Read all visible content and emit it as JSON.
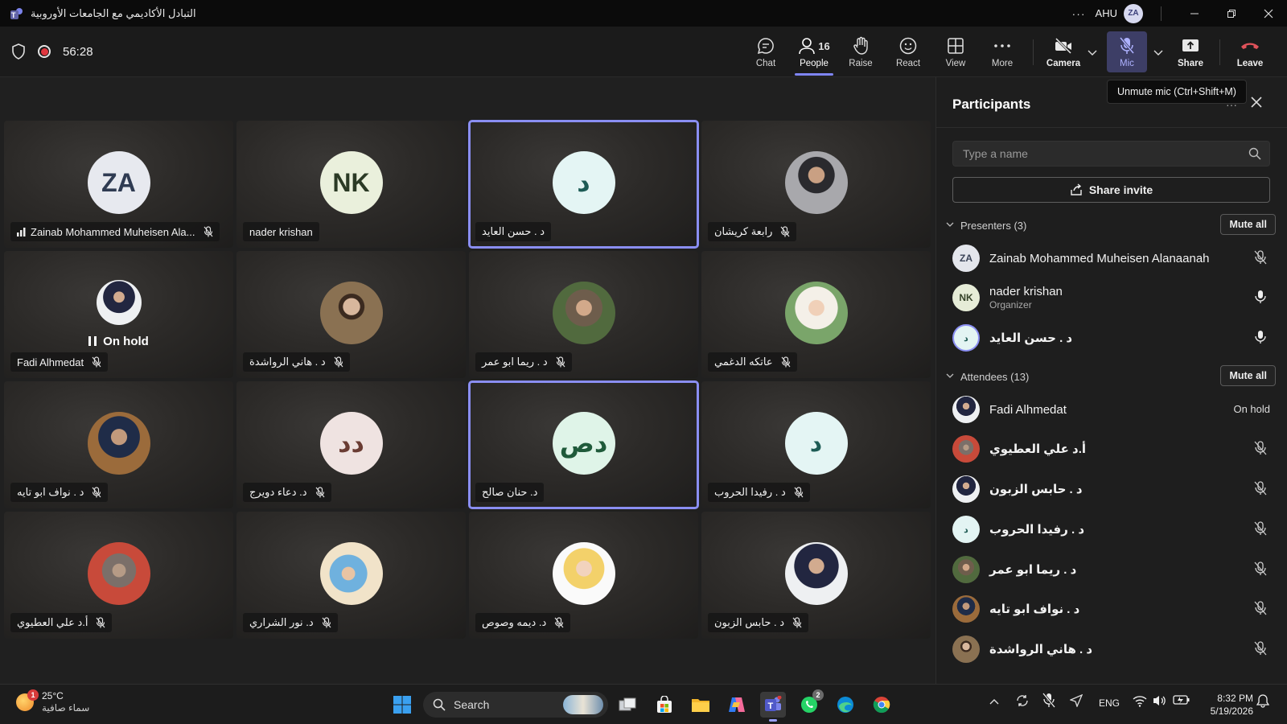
{
  "window": {
    "title": "التبادل الأكاديمي مع الجامعات الأوروبية",
    "org": "AHU",
    "avatar": "ZA",
    "more": "···"
  },
  "toolbar": {
    "timer": "56:28",
    "chat": "Chat",
    "people": "People",
    "people_count": "16",
    "raise": "Raise",
    "react": "React",
    "view": "View",
    "more": "More",
    "camera": "Camera",
    "mic": "Mic",
    "share": "Share",
    "leave": "Leave",
    "tooltip": "Unmute mic (Ctrl+Shift+M)"
  },
  "tiles": [
    {
      "name": "Zainab Mohammed Muheisen Ala...",
      "initials": "ZA"
    },
    {
      "name": "nader krishan",
      "initials": "NK"
    },
    {
      "name": "د . حسن العايد",
      "initials": "د"
    },
    {
      "name": "رابعة كريشان"
    },
    {
      "name": "Fadi Alhmedat",
      "status": "On hold"
    },
    {
      "name": "د . هاني الرواشدة"
    },
    {
      "name": "د . ريما ابو عمر"
    },
    {
      "name": "عاتكه الدغمي"
    },
    {
      "name": "د . نواف ابو تايه"
    },
    {
      "name": "د. دعاء دويرج",
      "initials": "دد"
    },
    {
      "name": "د. حنان صالح",
      "initials": "دص"
    },
    {
      "name": "د . رفيدا الحروب",
      "initials": "د"
    },
    {
      "name": "أ.د علي العطيوي"
    },
    {
      "name": "د. نور الشراري"
    },
    {
      "name": "د. ديمه وصوص"
    },
    {
      "name": "د . حابس الزبون"
    }
  ],
  "panel": {
    "title": "Participants",
    "search_placeholder": "Type a name",
    "share_invite": "Share invite",
    "presenters_title": "Presenters (3)",
    "attendees_title": "Attendees (13)",
    "mute_all": "Mute all",
    "presenters": [
      {
        "name": "Zainab Mohammed Muheisen Alanaanah",
        "initials": "ZA"
      },
      {
        "name": "nader krishan",
        "initials": "NK",
        "role": "Organizer"
      },
      {
        "name": "د . حسن العايد",
        "initials": "د"
      }
    ],
    "attendees": [
      {
        "name": "Fadi Alhmedat",
        "status": "On hold"
      },
      {
        "name": "أ.د علي العطيوي"
      },
      {
        "name": "د . حابس الزبون"
      },
      {
        "name": "د . رفيدا الحروب",
        "initials": "د"
      },
      {
        "name": "د . ريما ابو عمر"
      },
      {
        "name": "د . نواف ابو تايه"
      },
      {
        "name": "د . هاني الرواشدة"
      }
    ]
  },
  "taskbar": {
    "weather_temp": "25°C",
    "weather_cond": "سماء صافية",
    "weather_badge": "1",
    "search": "Search",
    "whatsapp_badge": "2",
    "lang": "ENG",
    "time": "8:32 PM",
    "date": "5/19/2026"
  }
}
